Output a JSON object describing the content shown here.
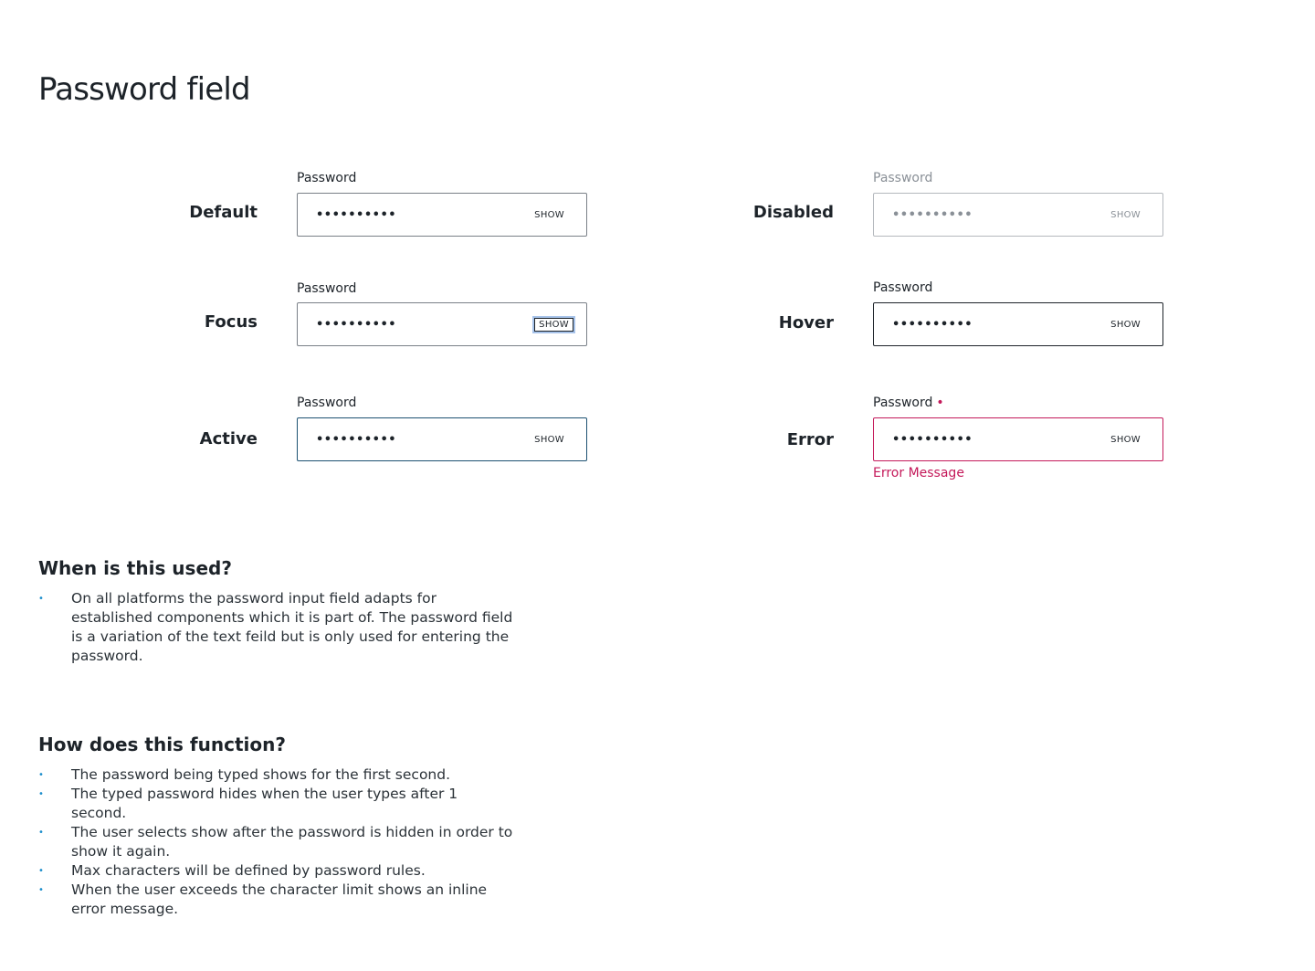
{
  "page": {
    "title": "Password field"
  },
  "fields": {
    "default": {
      "state": "Default",
      "label": "Password",
      "value": "••••••••••",
      "show": "SHOW"
    },
    "disabled": {
      "state": "Disabled",
      "label": "Password",
      "value": "••••••••••",
      "show": "SHOW"
    },
    "focus": {
      "state": "Focus",
      "label": "Password",
      "value": "••••••••••",
      "show": "SHOW"
    },
    "hover": {
      "state": "Hover",
      "label": "Password",
      "value": "••••••••••",
      "show": "SHOW"
    },
    "active": {
      "state": "Active",
      "label": "Password",
      "value": "••••••••••",
      "show": "SHOW"
    },
    "error": {
      "state": "Error",
      "label": "Password",
      "required_mark": "•",
      "value": "••••••••••",
      "show": "SHOW",
      "message": "Error Message"
    }
  },
  "colors": {
    "error": "#c4195a",
    "active_border": "#1c5172",
    "focus_ring": "#a7c3ea",
    "bullet": "#1a8dcb"
  },
  "usage": {
    "heading": "When is this used?",
    "items": [
      "On all platforms the password input field adapts for established components which it is part of. The password  field is a variation of the text feild but is only used for entering the password."
    ]
  },
  "function": {
    "heading": "How does this function?",
    "items": [
      "The password being typed shows for the first second.",
      "The typed password hides when the user types after 1 second.",
      "The user selects show after the password is hidden in order to show it again.",
      "Max characters will be defined by password rules.",
      "When the user exceeds the character limit shows an inline error message."
    ]
  }
}
